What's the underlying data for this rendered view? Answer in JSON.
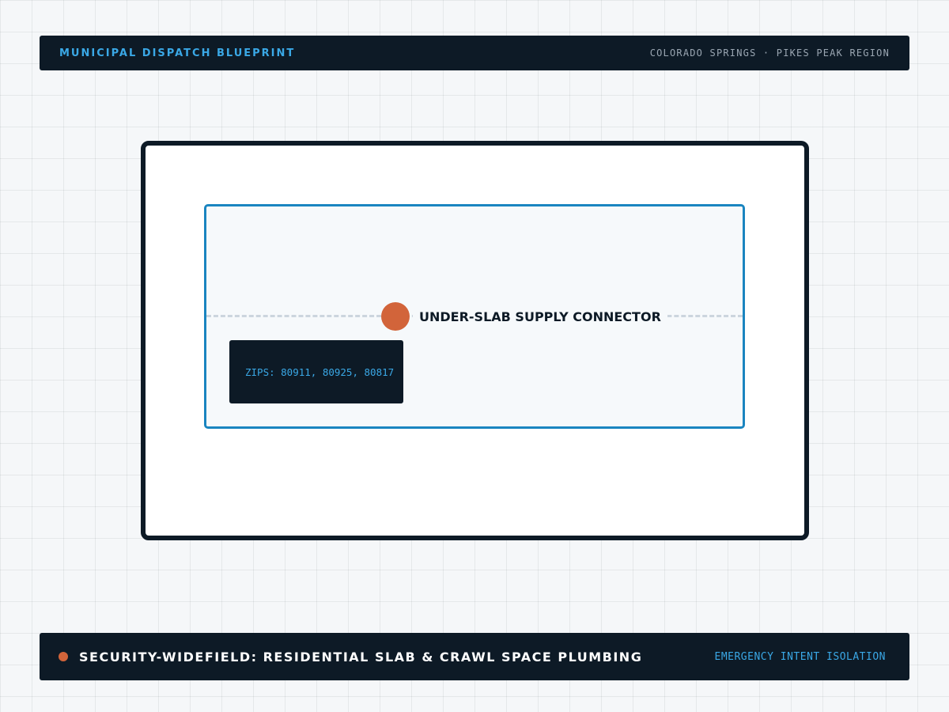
{
  "header": {
    "title": "MUNICIPAL DISPATCH BLUEPRINT",
    "region": "COLORADO SPRINGS · PIKES PEAK REGION"
  },
  "diagram": {
    "connector_label": "UNDER-SLAB SUPPLY CONNECTOR",
    "zips_text": "ZIPS: 80911, 80925, 80817"
  },
  "footer": {
    "location_title": "SECURITY-WIDEFIELD: RESIDENTIAL SLAB & CRAWL SPACE PLUMBING",
    "intent_label": "EMERGENCY INTENT ISOLATION"
  },
  "colors": {
    "navy": "#0d1a26",
    "accent_blue": "#3aa8e6",
    "panel_border": "#1a85c0",
    "node_orange": "#d2643a"
  }
}
